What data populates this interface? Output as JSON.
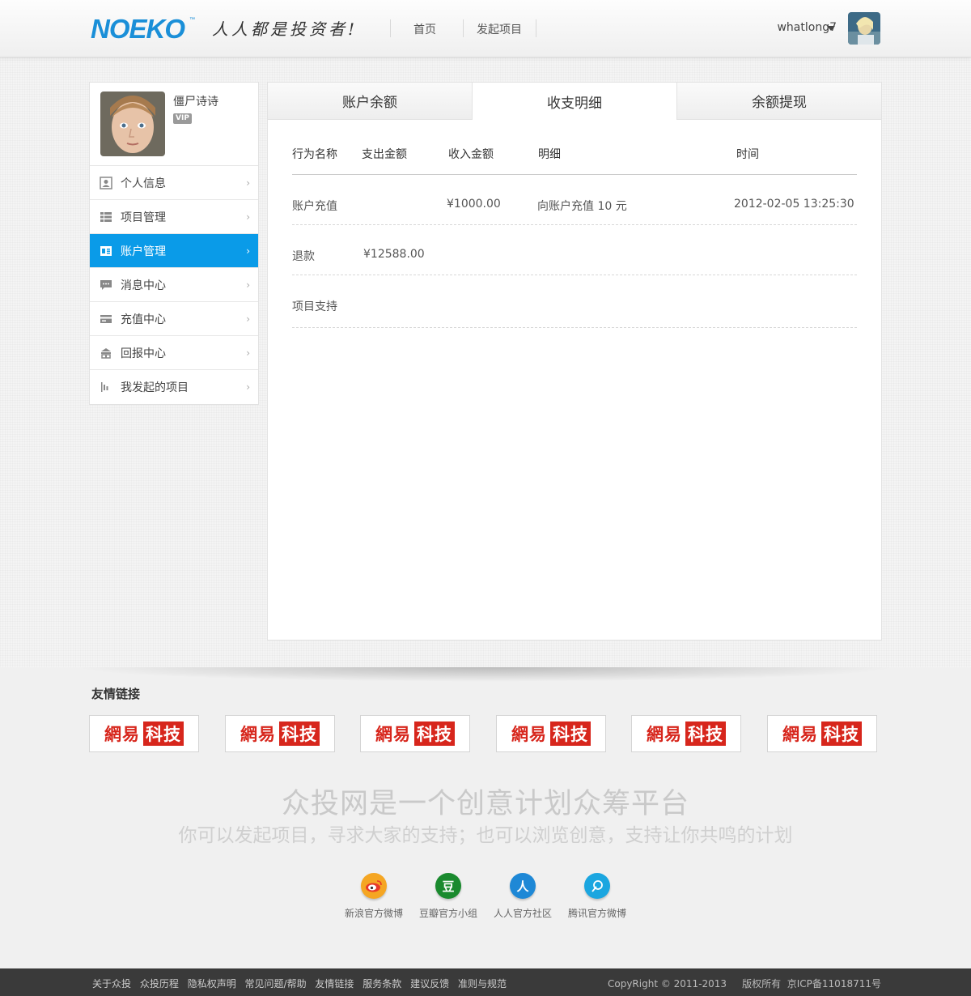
{
  "header": {
    "slogan": "人人都是投资者!",
    "nav": [
      "首页",
      "发起项目"
    ],
    "username": "whatlong7"
  },
  "sidebar": {
    "profile_name": "僵尸诗诗",
    "vip_label": "VIP",
    "items": [
      {
        "label": "个人信息",
        "icon": "user-card-icon"
      },
      {
        "label": "项目管理",
        "icon": "list-icon"
      },
      {
        "label": "账户管理",
        "icon": "account-icon"
      },
      {
        "label": "消息中心",
        "icon": "message-icon"
      },
      {
        "label": "充值中心",
        "icon": "card-icon"
      },
      {
        "label": "回报中心",
        "icon": "gift-icon"
      },
      {
        "label": "我发起的项目",
        "icon": "bars-icon"
      }
    ],
    "active_index": 2
  },
  "tabs": [
    "账户余额",
    "收支明细",
    "余额提现"
  ],
  "active_tab": 1,
  "table": {
    "headers": [
      "行为名称",
      "支出金额",
      "收入金额",
      "明细",
      "时间"
    ],
    "rows": [
      {
        "action": "账户充值",
        "expense": "",
        "income": "¥1000.00",
        "detail": "向账户充值 10 元",
        "time": "2012-02-05 13:25:30"
      },
      {
        "action": "退款",
        "expense": "¥12588.00",
        "income": "",
        "detail": "",
        "time": ""
      },
      {
        "action": "项目支持",
        "expense": "",
        "income": "",
        "detail": "",
        "time": ""
      }
    ]
  },
  "footer": {
    "links_title": "友情链接",
    "partner_logo": {
      "part_a": "網易",
      "part_b": "科技"
    },
    "headline": "众投网是一个创意计划众筹平台",
    "subline": "你可以发起项目，寻求大家的支持；也可以浏览创意，支持让你共鸣的计划",
    "social": [
      {
        "label": "新浪官方微博",
        "icon": "weibo-icon",
        "glyph": "",
        "color": "#f5a623"
      },
      {
        "label": "豆瓣官方小组",
        "icon": "douban-icon",
        "glyph": "豆",
        "color": "#1a8a2e"
      },
      {
        "label": "人人官方社区",
        "icon": "renren-icon",
        "glyph": "人",
        "color": "#1e88d6"
      },
      {
        "label": "腾讯官方微博",
        "icon": "tencent-weibo-icon",
        "glyph": "",
        "color": "#1ba6e0"
      }
    ],
    "bottom_links": [
      "关于众投",
      "众投历程",
      "隐私权声明",
      "常见问题/帮助",
      "友情链接",
      "服务条款",
      "建议反馈",
      "准则与规范"
    ],
    "copyright": "CopyRight © 2011-2013     版权所有  京ICP备11018711号"
  },
  "colors": {
    "accent": "#0a9be8",
    "logo": "#1a8fd8",
    "partner_red": "#d7261c"
  }
}
